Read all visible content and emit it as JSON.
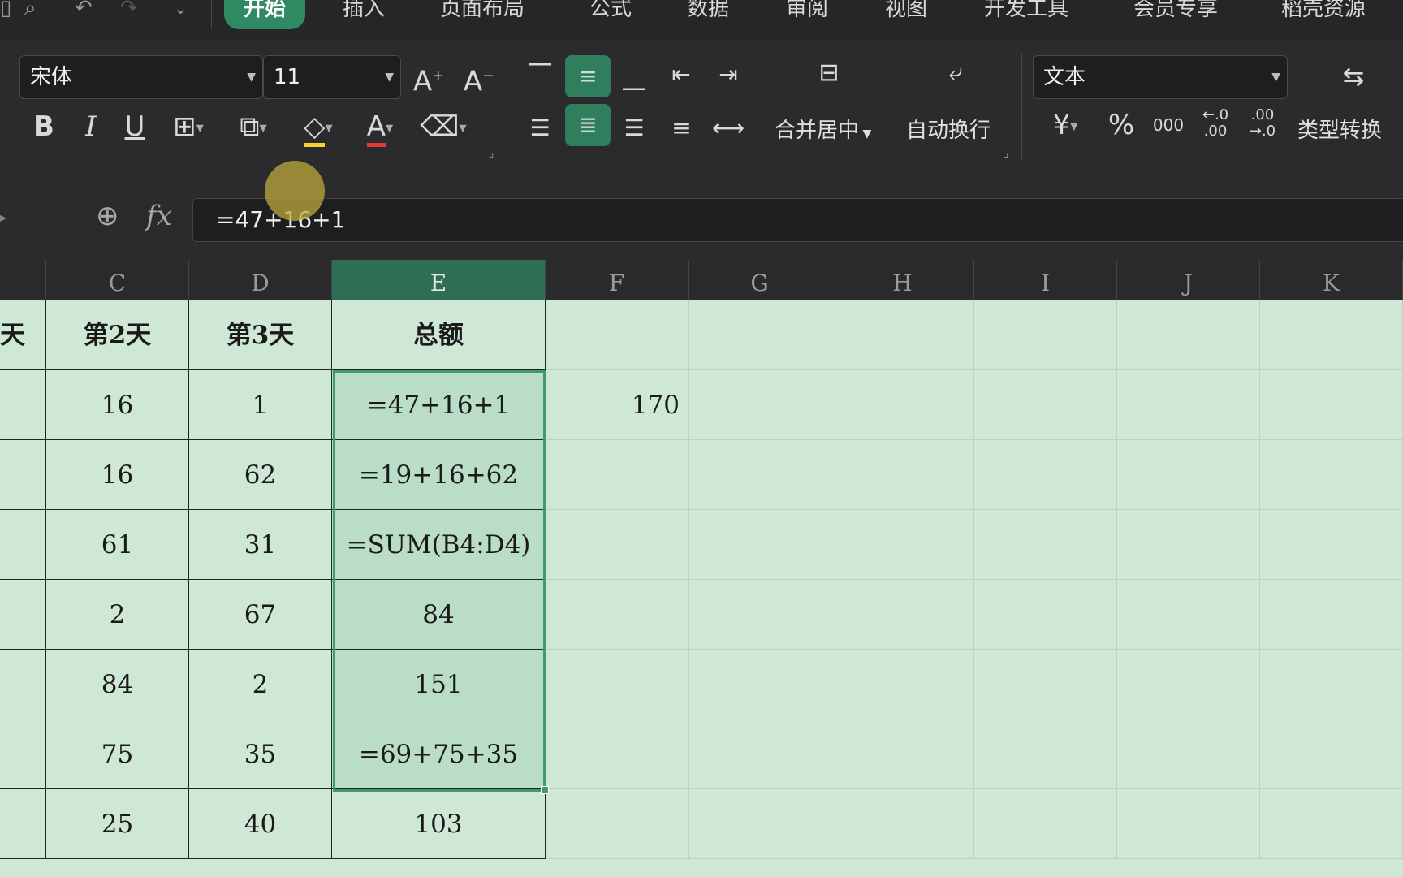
{
  "menu": {
    "tabs": [
      {
        "label": "开始",
        "active": true
      },
      {
        "label": "插入"
      },
      {
        "label": "页面布局"
      },
      {
        "label": "公式"
      },
      {
        "label": "数据"
      },
      {
        "label": "审阅"
      },
      {
        "label": "视图"
      },
      {
        "label": "开发工具"
      },
      {
        "label": "会员专享"
      },
      {
        "label": "稻壳资源"
      }
    ]
  },
  "ribbon": {
    "font_name": "宋体",
    "font_size": "11",
    "merge_center": "合并居中",
    "wrap_text": "自动换行",
    "number_format": "文本",
    "type_convert": "类型转换",
    "currency_symbol": "¥",
    "percent_symbol": "%",
    "thousands_symbol": "000",
    "increase_decimal": "←.0\n.00",
    "decrease_decimal": ".00\n→.0"
  },
  "formula_bar": {
    "fx_label": "fx",
    "value": "=47+16+1"
  },
  "columns": [
    "C",
    "D",
    "E",
    "F",
    "G",
    "H",
    "I",
    "J",
    "K"
  ],
  "selected_column": "E",
  "table": {
    "partial_header": "天",
    "headers": [
      "第2天",
      "第3天",
      "总额"
    ],
    "rows": [
      {
        "c": "16",
        "d": "1",
        "e": "=47+16+1",
        "f": "170"
      },
      {
        "c": "16",
        "d": "62",
        "e": "=19+16+62",
        "f": ""
      },
      {
        "c": "61",
        "d": "31",
        "e": "=SUM(B4:D4)",
        "f": ""
      },
      {
        "c": "2",
        "d": "67",
        "e": "84",
        "f": ""
      },
      {
        "c": "84",
        "d": "2",
        "e": "151",
        "f": ""
      },
      {
        "c": "75",
        "d": "35",
        "e": "=69+75+35",
        "f": ""
      },
      {
        "c": "25",
        "d": "40",
        "e": "103",
        "f": ""
      }
    ]
  },
  "colors": {
    "accent": "#2f8a63",
    "sheet_bg": "#cfe8d6",
    "selection": "#3f9b6e"
  }
}
